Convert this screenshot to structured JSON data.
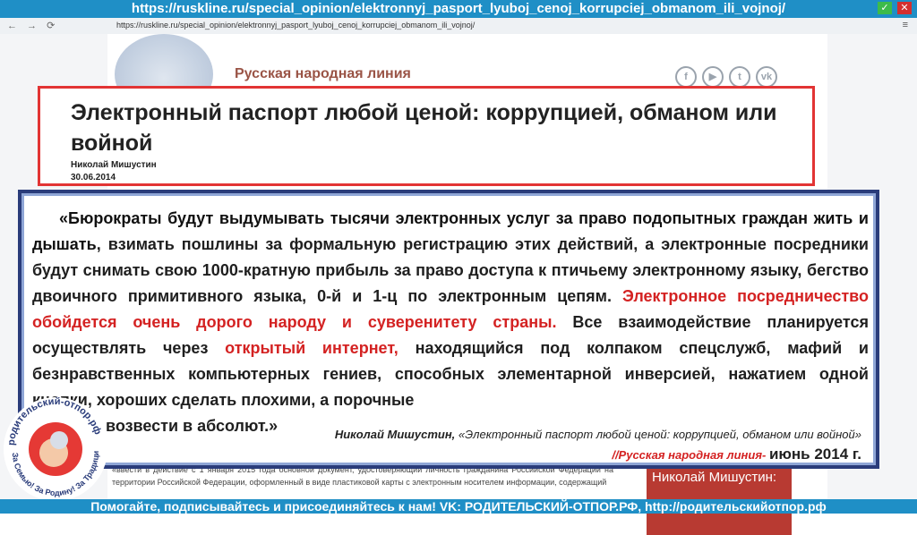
{
  "slide_url": "https://ruskline.ru/special_opinion/elektronnyj_pasport_lyuboj_cenoj_korrupciej_obmanom_ili_vojnoj/",
  "browser": {
    "address": "https://ruskline.ru/special_opinion/elektronnyj_pasport_lyuboj_cenoj_korrupciej_obmanom_ili_vojnoj/"
  },
  "site": {
    "title": "Русская народная линия",
    "social_icons": [
      "facebook-icon",
      "youtube-icon",
      "twitter-icon",
      "vk-icon"
    ],
    "author_box_label": "Николай Мишустин:",
    "bg_article": "«ввести в действие с 1 января 2015 года основной документ, удостоверяющий личность гражданина Российской Федерации на территории Российской Федерации, оформленный в виде пластиковой карты с электронным носителем информации, содержащий"
  },
  "article": {
    "title": "Электронный паспорт любой ценой: коррупцией, обманом или войной",
    "author": "Николай Мишустин",
    "date": "30.06.2014"
  },
  "quote": {
    "part1": "«Бюрократы будут выдумывать тысячи электронных услуг за право подопытных граждан жить и дышать",
    "part2": ", взимать пошлины за формальную регистрацию этих действий, а электронные посредники будут снимать свою 1000-кратную прибыль за право доступа к птичьему электронному языку, бегство двоичного примитивного языка, 0-й и 1-ц по электронным цепям. ",
    "red1": "Электронное посредничество обойдется очень дорого народу и суверенитету страны.",
    "part3": " Все взаимодействие планируется осуществлять через ",
    "red2": "открытый интернет,",
    "part4": " находящийся под колпаком спецслужб, мафий и безнравственных компьютерных гениев, способных элементарной инверсией, нажатием одной кнопки, хороших сделать плохими, а порочные",
    "part5": "возвести в абсолют.»",
    "attribution_author": "Николай Мишустин,",
    "attribution_title": " «Электронный паспорт любой ценой: коррупцией, обманом или войной»",
    "source": "//Русская народная линия- ",
    "source_date": "июнь 2014 г."
  },
  "logo": {
    "text_top": "родительский-отпор.рф",
    "text_bottom": "За Семью! За Родину! За Традиции!"
  },
  "footer": "Помогайте, подписывайтесь и присоединяйтесь к нам! VK: РОДИТЕЛЬСКИЙ-ОТПОР.РФ, http://родительскийотпор.рф"
}
